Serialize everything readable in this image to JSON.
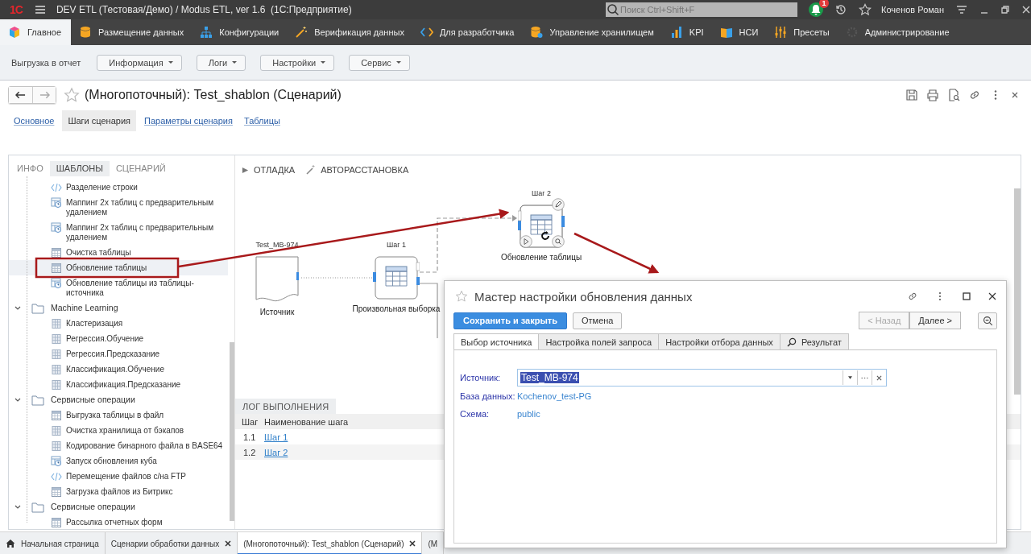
{
  "app": {
    "logo": "1С",
    "title": "DEV ETL (Тестовая/Демо) / Modus ETL, ver 1.6  (1С:Предприятие)"
  },
  "search": {
    "placeholder": "Поиск Ctrl+Shift+F"
  },
  "notifications": {
    "count": "1"
  },
  "user": {
    "name": "Коченов Роман"
  },
  "sections": [
    {
      "label": "Главное",
      "kind": "cube",
      "selected": true
    },
    {
      "label": "Размещение данных",
      "kind": "database",
      "selected": false
    },
    {
      "label": "Конфигурации",
      "kind": "hierarchy",
      "selected": false
    },
    {
      "label": "Верификация данных",
      "kind": "wand",
      "selected": false
    },
    {
      "label": "Для разработчика",
      "kind": "code",
      "selected": false
    },
    {
      "label": "Управление хранилищем",
      "kind": "storage",
      "selected": false
    },
    {
      "label": "KPI",
      "kind": "chart",
      "selected": false
    },
    {
      "label": "НСИ",
      "kind": "book",
      "selected": false
    },
    {
      "label": "Пресеты",
      "kind": "sliders",
      "selected": false
    },
    {
      "label": "Администрирование",
      "kind": "gear",
      "selected": false
    }
  ],
  "command_bar": {
    "label": "Выгрузка в отчет",
    "menus": [
      "Информация",
      "Логи",
      "Настройки",
      "Сервис"
    ]
  },
  "form": {
    "title": "(Многопоточный): Test_shablon (Сценарий)",
    "tabs": [
      {
        "label": "Основное",
        "selected": false
      },
      {
        "label": "Шаги сценария",
        "selected": true
      },
      {
        "label": "Параметры сценария",
        "selected": false
      },
      {
        "label": "Таблицы",
        "selected": false
      }
    ]
  },
  "left_panel": {
    "tabs": [
      {
        "label": "ИНФО",
        "selected": false
      },
      {
        "label": "ШАБЛОНЫ",
        "selected": true
      },
      {
        "label": "СЦЕНАРИЙ",
        "selected": false
      }
    ],
    "tree": [
      {
        "kind": "script",
        "label": "Разделение строки",
        "selected": false
      },
      {
        "kind": "mapping",
        "label": "Маппинг 2х таблиц с предварительным удалением",
        "selected": false
      },
      {
        "kind": "mapping",
        "label": "Маппинг 2х таблиц с предварительным удалением",
        "selected": false
      },
      {
        "kind": "table",
        "label": "Очистка таблицы",
        "selected": false
      },
      {
        "kind": "table",
        "label": "Обновление таблицы",
        "selected": true
      },
      {
        "kind": "mapping",
        "label": "Обновление таблицы из таблицы-источника",
        "selected": false
      },
      {
        "kind": "folder",
        "label": "Machine Learning",
        "expanded": true,
        "selected": false,
        "children": [
          {
            "kind": "grid",
            "label": "Кластеризация",
            "selected": false
          },
          {
            "kind": "grid",
            "label": "Регрессия.Обучение",
            "selected": false
          },
          {
            "kind": "grid",
            "label": "Регрессия.Предсказание",
            "selected": false
          },
          {
            "kind": "grid",
            "label": "Классификация.Обучение",
            "selected": false
          },
          {
            "kind": "grid",
            "label": "Классификация.Предсказание",
            "selected": false
          }
        ]
      },
      {
        "kind": "folder",
        "label": "Сервисные операции",
        "expanded": true,
        "selected": false,
        "children": [
          {
            "kind": "table",
            "label": "Выгрузка таблицы в файл",
            "selected": false
          },
          {
            "kind": "grid",
            "label": "Очистка хранилища от бэкапов",
            "selected": false
          },
          {
            "kind": "grid",
            "label": "Кодирование бинарного файла в BASE64",
            "selected": false
          },
          {
            "kind": "mapping",
            "label": "Запуск обновления куба",
            "selected": false
          },
          {
            "kind": "script",
            "label": "Перемещение файлов с/на FTP",
            "selected": false
          },
          {
            "kind": "table",
            "label": "Загрузка файлов из Битрикс",
            "selected": false
          }
        ]
      },
      {
        "kind": "folder",
        "label": "Сервисные операции",
        "expanded": true,
        "selected": false,
        "children": [
          {
            "kind": "table",
            "label": "Рассылка отчетных форм",
            "selected": false
          }
        ]
      }
    ]
  },
  "diagram": {
    "toolbar": [
      {
        "kind": "play",
        "label": "ОТЛАДКА"
      },
      {
        "kind": "wand",
        "label": "АВТОРАССТАНОВКА"
      }
    ],
    "nodes": [
      {
        "kind": "source",
        "caption": "Test_MB-974",
        "label": "Источник",
        "selected": false
      },
      {
        "kind": "table",
        "caption": "Шаг 1",
        "label": "Произвольная выборка",
        "selected": false
      },
      {
        "kind": "table",
        "caption": "Шаг 2",
        "label": "Обновление таблицы",
        "selected": true
      }
    ]
  },
  "log": {
    "tab": "ЛОГ ВЫПОЛНЕНИЯ",
    "columns": [
      "Шаг",
      "Наименование шага"
    ],
    "rows": [
      {
        "step": "1.1",
        "name": "Шаг 1"
      },
      {
        "step": "1.2",
        "name": "Шаг 2"
      }
    ]
  },
  "dialog": {
    "title": "Мастер настройки обновления данных",
    "buttons": [
      {
        "label": "Сохранить и закрыть",
        "kind": "primary",
        "disabled": false
      },
      {
        "label": "Отмена",
        "kind": "plain",
        "disabled": false
      }
    ],
    "nav": [
      {
        "label": "< Назад",
        "disabled": true
      },
      {
        "label": "Далее >",
        "disabled": false
      }
    ],
    "tabs": [
      {
        "label": "Выбор источника",
        "selected": true,
        "kind": "plain"
      },
      {
        "label": "Настройка полей запроса",
        "selected": false,
        "kind": "plain"
      },
      {
        "label": "Настройки отбора данных",
        "selected": false,
        "kind": "plain"
      },
      {
        "label": "Результат",
        "selected": false,
        "kind": "search"
      }
    ],
    "source": {
      "label": "Источник:",
      "value": "Test_MB-974"
    },
    "info": [
      {
        "label": "База данных:",
        "value": "Kochenov_test-PG"
      },
      {
        "label": "Схема:",
        "value": "public"
      }
    ]
  },
  "open_windows": [
    {
      "label": "Начальная страница",
      "kind": "home",
      "closable": false,
      "selected": false
    },
    {
      "label": "Сценарии обработки данных",
      "kind": "plain",
      "closable": true,
      "selected": false
    },
    {
      "label": "(Многопоточный): Test_shablon (Сценарий)",
      "kind": "plain",
      "closable": true,
      "selected": true
    },
    {
      "label": "(М",
      "kind": "plain",
      "closable": false,
      "selected": false
    }
  ]
}
